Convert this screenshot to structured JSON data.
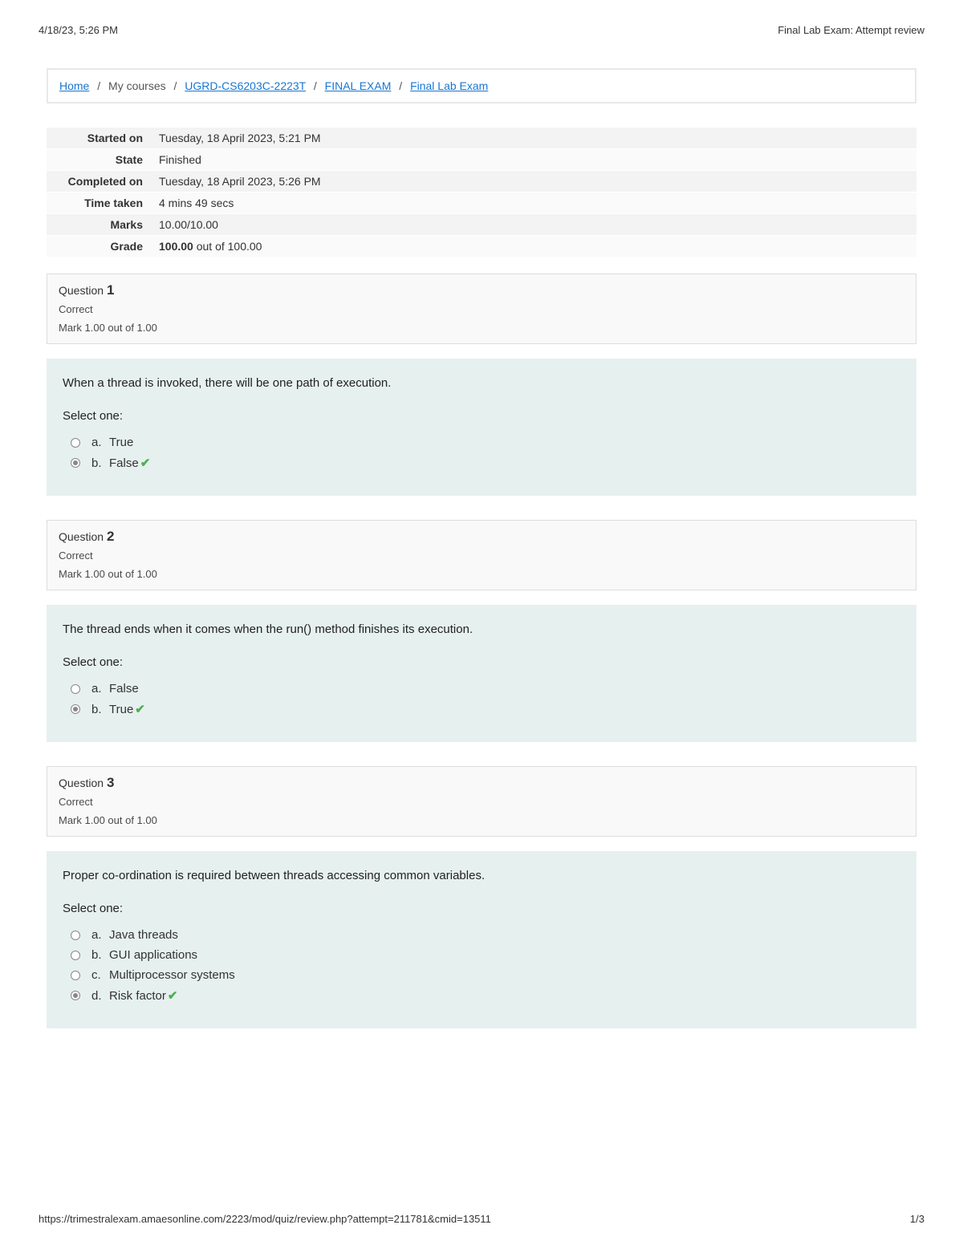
{
  "print_header": {
    "left": "4/18/23, 5:26 PM",
    "right": "Final Lab Exam: Attempt review"
  },
  "breadcrumb": {
    "home": "Home",
    "mycourses": "My courses",
    "course": "UGRD-CS6203C-2223T",
    "section": "FINAL EXAM",
    "activity": "Final Lab Exam"
  },
  "summary": {
    "started_on_label": "Started on",
    "started_on": "Tuesday, 18 April 2023, 5:21 PM",
    "state_label": "State",
    "state": "Finished",
    "completed_on_label": "Completed on",
    "completed_on": "Tuesday, 18 April 2023, 5:26 PM",
    "time_taken_label": "Time taken",
    "time_taken": "4 mins 49 secs",
    "marks_label": "Marks",
    "marks": "10.00/10.00",
    "grade_label": "Grade",
    "grade_value": "100.00",
    "grade_suffix": " out of 100.00"
  },
  "question_label_prefix": "Question ",
  "select_one": "Select one:",
  "q1": {
    "number": "1",
    "status": "Correct",
    "mark": "Mark 1.00 out of 1.00",
    "text": "When a thread is invoked, there will be one path of execution.",
    "opt_a_letter": "a.",
    "opt_a_text": "True",
    "opt_b_letter": "b.",
    "opt_b_text": "False"
  },
  "q2": {
    "number": "2",
    "status": "Correct",
    "mark": "Mark 1.00 out of 1.00",
    "text": "The thread ends when it comes when the run() method finishes its execution.",
    "opt_a_letter": "a.",
    "opt_a_text": "False",
    "opt_b_letter": "b.",
    "opt_b_text": "True"
  },
  "q3": {
    "number": "3",
    "status": "Correct",
    "mark": "Mark 1.00 out of 1.00",
    "text": "Proper co-ordination is required between threads accessing common variables.",
    "opt_a_letter": "a.",
    "opt_a_text": "Java threads",
    "opt_b_letter": "b.",
    "opt_b_text": "GUI applications",
    "opt_c_letter": "c.",
    "opt_c_text": "Multiprocessor systems",
    "opt_d_letter": "d.",
    "opt_d_text": "Risk factor"
  },
  "print_footer": {
    "left": "https://trimestralexam.amaesonline.com/2223/mod/quiz/review.php?attempt=211781&cmid=13511",
    "right": "1/3"
  }
}
